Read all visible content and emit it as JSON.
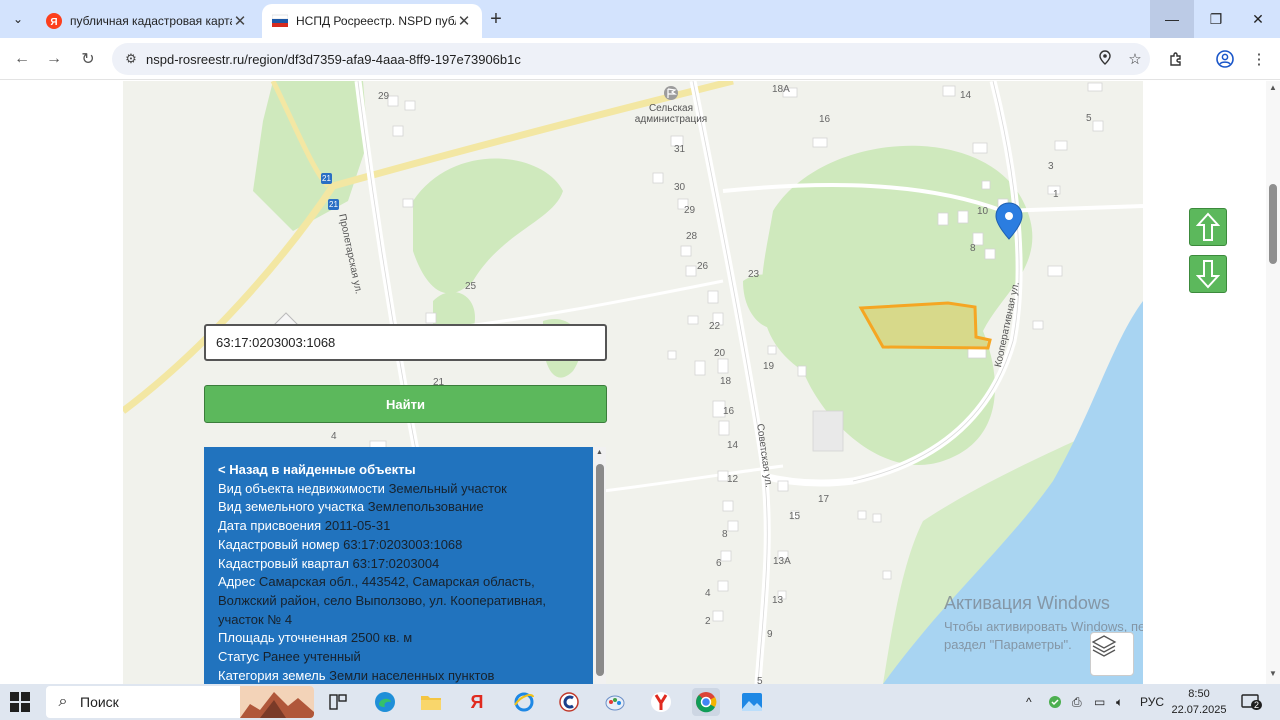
{
  "browser": {
    "tabs": [
      {
        "title": "публичная кадастровая карта",
        "favicon": "yandex-icon"
      },
      {
        "title": "НСПД Росреестр. NSPD публи",
        "favicon": "russia-flag-icon"
      }
    ],
    "url": "nspd-rosreestr.ru/region/df3d7359-afa9-4aaa-8ff9-197e73906b1c"
  },
  "map": {
    "place_labels": {
      "admin": "Сельская администрация"
    },
    "streets": {
      "proletarskaya": "Пролетарская ул.",
      "sovetskaya": "Советская ул.",
      "kooperativnaya": "Кооперативная ул."
    },
    "house_numbers": [
      "29",
      "18А",
      "14",
      "5",
      "16",
      "3",
      "31",
      "1",
      "30",
      "29",
      "10",
      "28",
      "8",
      "26",
      "23",
      "25",
      "22",
      "20",
      "19",
      "18",
      "16",
      "14",
      "12",
      "17",
      "15",
      "8",
      "6",
      "13А",
      "4",
      "13",
      "2",
      "9",
      "5",
      "4",
      "21"
    ],
    "route_badge": "21"
  },
  "search": {
    "value": "63:17:0203003:1068",
    "button_label": "Найти"
  },
  "info": {
    "back_label": "< Назад в найденные объекты",
    "rows": [
      {
        "label": "Вид объекта недвижимости",
        "value": "Земельный участок"
      },
      {
        "label": "Вид земельного участка",
        "value": "Землепользование"
      },
      {
        "label": "Дата присвоения",
        "value": "2011-05-31"
      },
      {
        "label": "Кадастровый номер",
        "value": "63:17:0203003:1068"
      },
      {
        "label": "Кадастровый квартал",
        "value": "63:17:0203004"
      },
      {
        "label": "Адрес",
        "value": "Самарская обл., 443542, Самарская область, Волжский район, село Выползово, ул. Кооперативная, участок № 4"
      },
      {
        "label": "Площадь уточненная",
        "value": "2500 кв. м"
      },
      {
        "label": "Статус",
        "value": "Ранее учтенный"
      },
      {
        "label": "Категория земель",
        "value": "Земли населенных пунктов"
      }
    ]
  },
  "watermark": {
    "line1": "Активация Windows",
    "line2": "Чтобы активировать Windows, перейдите в",
    "line3": "раздел \"Параметры\"."
  },
  "taskbar": {
    "search_placeholder": "Поиск",
    "lang": "РУС",
    "time": "8:50",
    "date": "22.07.2025",
    "notifications": "2"
  },
  "colors": {
    "accent_green": "#5cb85c",
    "panel_blue": "#2173be",
    "parcel_fill": "#d9d37a",
    "parcel_stroke": "#f5a623",
    "water": "#a8d4f2",
    "forest": "#cfe9bd"
  }
}
